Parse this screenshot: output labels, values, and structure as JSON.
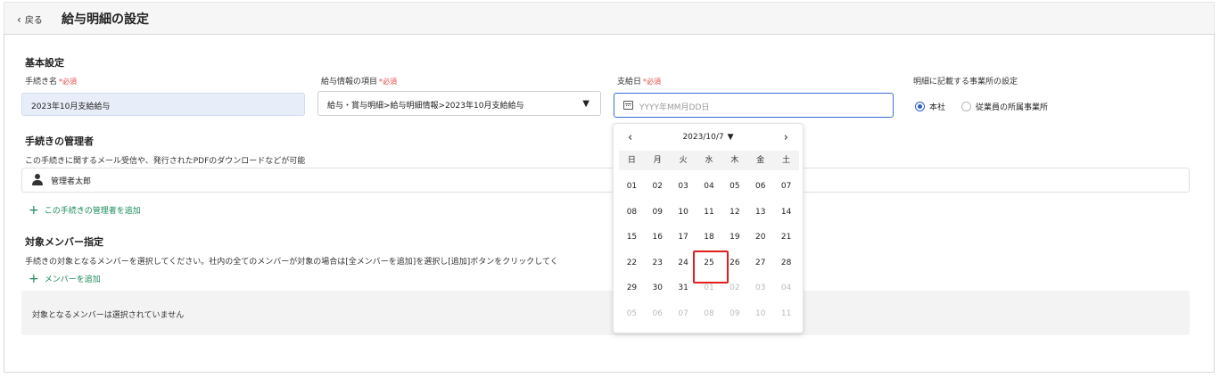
{
  "header": {
    "back_label": "戻る",
    "title": "給与明細の設定"
  },
  "basic": {
    "section_title": "基本設定",
    "required_mark": "*必須",
    "procname_label": "手続き名",
    "procname_value": "2023年10月支給給与",
    "item_label": "給与情報の項目",
    "item_value": "給与・賞与明細>給与明細情報>2023年10月支給給与",
    "payday_label": "支給日",
    "payday_placeholder": "YYYY年MM月DD日",
    "office_label": "明細に記載する事業所の設定",
    "office_options": [
      "本社",
      "従業員の所属事業所"
    ],
    "office_selected": "本社"
  },
  "manager": {
    "section_title": "手続きの管理者",
    "description": "この手続きに関するメール受信や、発行されたPDFのダウンロードなどが可能",
    "name": "管理者太郎",
    "add_label": "この手続きの管理者を追加"
  },
  "members": {
    "section_title": "対象メンバー指定",
    "description": "手続きの対象となるメンバーを選択してください。社内の全てのメンバーが対象の場合は[全メンバーを追加]を選択し[追加]ボタンをクリックしてく",
    "add_label": "メンバーを追加",
    "empty_text": "対象となるメンバーは選択されていません"
  },
  "calendar": {
    "month_label": "2023/10/7",
    "weekdays": [
      "日",
      "月",
      "火",
      "水",
      "木",
      "金",
      "土"
    ],
    "days": [
      {
        "d": "01",
        "other": false
      },
      {
        "d": "02",
        "other": false
      },
      {
        "d": "03",
        "other": false
      },
      {
        "d": "04",
        "other": false
      },
      {
        "d": "05",
        "other": false
      },
      {
        "d": "06",
        "other": false
      },
      {
        "d": "07",
        "other": false
      },
      {
        "d": "08",
        "other": false
      },
      {
        "d": "09",
        "other": false
      },
      {
        "d": "10",
        "other": false
      },
      {
        "d": "11",
        "other": false
      },
      {
        "d": "12",
        "other": false
      },
      {
        "d": "13",
        "other": false
      },
      {
        "d": "14",
        "other": false
      },
      {
        "d": "15",
        "other": false
      },
      {
        "d": "16",
        "other": false
      },
      {
        "d": "17",
        "other": false
      },
      {
        "d": "18",
        "other": false
      },
      {
        "d": "19",
        "other": false
      },
      {
        "d": "20",
        "other": false
      },
      {
        "d": "21",
        "other": false
      },
      {
        "d": "22",
        "other": false
      },
      {
        "d": "23",
        "other": false
      },
      {
        "d": "24",
        "other": false
      },
      {
        "d": "25",
        "other": false
      },
      {
        "d": "26",
        "other": false
      },
      {
        "d": "27",
        "other": false
      },
      {
        "d": "28",
        "other": false
      },
      {
        "d": "29",
        "other": false
      },
      {
        "d": "30",
        "other": false
      },
      {
        "d": "31",
        "other": false
      },
      {
        "d": "01",
        "other": true
      },
      {
        "d": "02",
        "other": true
      },
      {
        "d": "03",
        "other": true
      },
      {
        "d": "04",
        "other": true
      },
      {
        "d": "05",
        "other": true
      },
      {
        "d": "06",
        "other": true
      },
      {
        "d": "07",
        "other": true
      },
      {
        "d": "08",
        "other": true
      },
      {
        "d": "09",
        "other": true
      },
      {
        "d": "10",
        "other": true
      },
      {
        "d": "11",
        "other": true
      }
    ],
    "highlighted_day": "25"
  },
  "colors": {
    "accent": "#2f5fc4",
    "link": "#1a8a5a",
    "required": "#e64545",
    "highlight": "#e01e1e"
  }
}
